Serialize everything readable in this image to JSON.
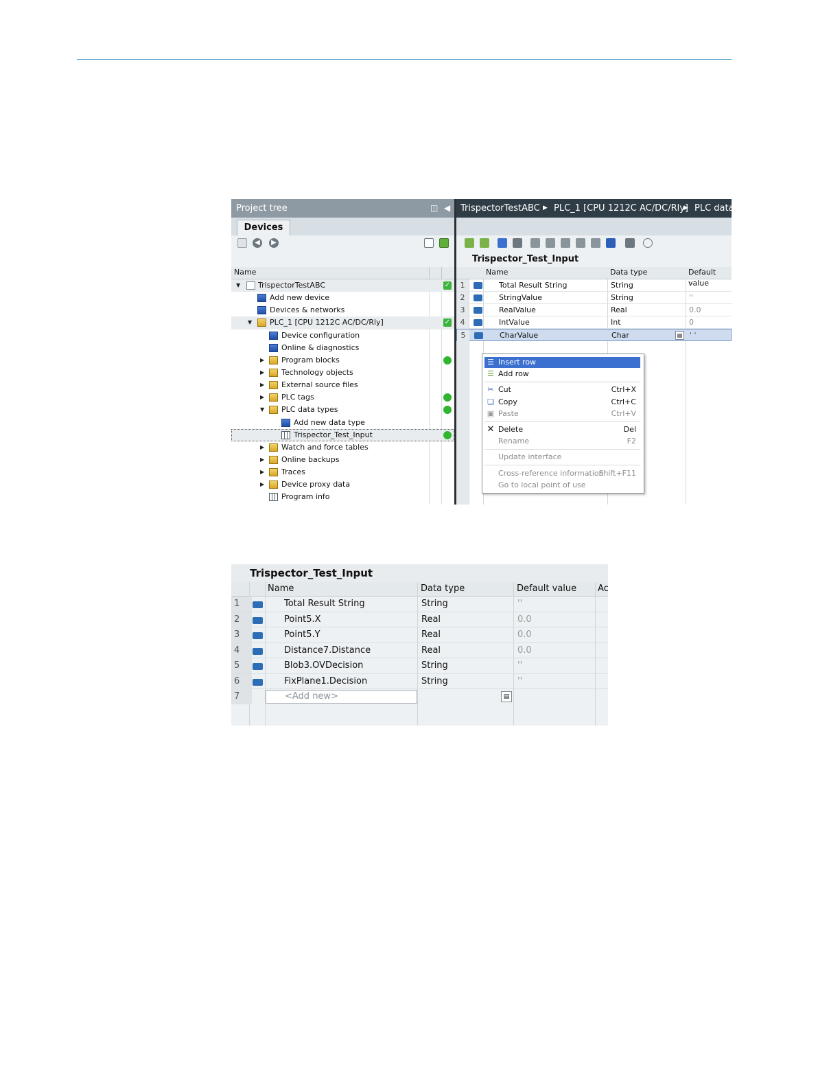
{
  "shot1": {
    "project_tree": {
      "title": "Project tree",
      "tab": "Devices",
      "column_name": "Name",
      "items": [
        {
          "label": "TrispectorTestABC",
          "status": "ok"
        },
        {
          "label": "Add new device",
          "status": ""
        },
        {
          "label": "Devices & networks",
          "status": ""
        },
        {
          "label": "PLC_1 [CPU 1212C AC/DC/Rly]",
          "status": "ok"
        },
        {
          "label": "Device configuration",
          "status": ""
        },
        {
          "label": "Online & diagnostics",
          "status": ""
        },
        {
          "label": "Program blocks",
          "status": "dot"
        },
        {
          "label": "Technology objects",
          "status": ""
        },
        {
          "label": "External source files",
          "status": ""
        },
        {
          "label": "PLC tags",
          "status": "dot"
        },
        {
          "label": "PLC data types",
          "status": "dot"
        },
        {
          "label": "Add new data type",
          "status": ""
        },
        {
          "label": "Trispector_Test_Input",
          "status": "dot"
        },
        {
          "label": "Watch and force tables",
          "status": ""
        },
        {
          "label": "Online backups",
          "status": ""
        },
        {
          "label": "Traces",
          "status": ""
        },
        {
          "label": "Device proxy data",
          "status": ""
        },
        {
          "label": "Program info",
          "status": ""
        }
      ]
    },
    "editor": {
      "breadcrumb": [
        "TrispectorTestABC",
        "PLC_1 [CPU 1212C AC/DC/Rly]",
        "PLC data"
      ],
      "table_title": "Trispector_Test_Input",
      "columns": [
        "Name",
        "Data type",
        "Default value"
      ],
      "rows": [
        {
          "num": "1",
          "name": "Total Result String",
          "type": "String",
          "default": "''"
        },
        {
          "num": "2",
          "name": "StringValue",
          "type": "String",
          "default": "''"
        },
        {
          "num": "3",
          "name": "RealValue",
          "type": "Real",
          "default": "0.0"
        },
        {
          "num": "4",
          "name": "IntValue",
          "type": "Int",
          "default": "0"
        },
        {
          "num": "5",
          "name": "CharValue",
          "type": "Char",
          "default": "' '"
        }
      ]
    },
    "context_menu": {
      "insert_row": "Insert row",
      "add_row": "Add row",
      "cut": "Cut",
      "cut_sc": "Ctrl+X",
      "copy": "Copy",
      "copy_sc": "Ctrl+C",
      "paste": "Paste",
      "paste_sc": "Ctrl+V",
      "delete": "Delete",
      "delete_sc": "Del",
      "rename": "Rename",
      "rename_sc": "F2",
      "update_interface": "Update interface",
      "cross_ref": "Cross-reference information",
      "cross_ref_sc": "Shift+F11",
      "go_local": "Go to local point of use"
    }
  },
  "shot2": {
    "table_title": "Trispector_Test_Input",
    "columns": [
      "Name",
      "Data type",
      "Default value",
      "Ac"
    ],
    "rows": [
      {
        "num": "1",
        "name": "Total Result String",
        "type": "String",
        "default": "''"
      },
      {
        "num": "2",
        "name": "Point5.X",
        "type": "Real",
        "default": "0.0"
      },
      {
        "num": "3",
        "name": "Point5.Y",
        "type": "Real",
        "default": "0.0"
      },
      {
        "num": "4",
        "name": "Distance7.Distance",
        "type": "Real",
        "default": "0.0"
      },
      {
        "num": "5",
        "name": "Blob3.OVDecision",
        "type": "String",
        "default": "''"
      },
      {
        "num": "6",
        "name": "FixPlane1.Decision",
        "type": "String",
        "default": "''"
      }
    ],
    "add_new": {
      "num": "7",
      "placeholder": "<Add new>"
    }
  },
  "colors": {
    "accent_rule": "#4aa3c8",
    "menu_highlight": "#3b6fd0",
    "status_green": "#2fb52f"
  }
}
